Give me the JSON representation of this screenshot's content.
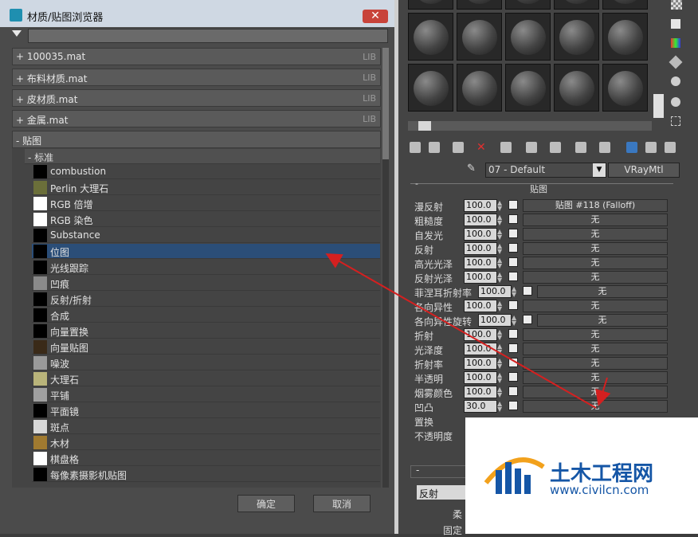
{
  "dialog": {
    "title": "材质/贴图浏览器",
    "close_glyph": "✕",
    "categories": [
      {
        "label": "+ 100035.mat",
        "tag": "LIB"
      },
      {
        "label": "+ 布料材质.mat",
        "tag": "LIB"
      },
      {
        "label": "+ 皮材质.mat",
        "tag": "LIB"
      },
      {
        "label": "+ 金属.mat",
        "tag": "LIB"
      }
    ],
    "maps_group": "- 贴图",
    "maps_subgroup": "- 标准",
    "maps": [
      {
        "name": "combustion",
        "swatch": "#000000"
      },
      {
        "name": "Perlin 大理石",
        "swatch": "#6b6f3a"
      },
      {
        "name": "RGB 倍增",
        "swatch": "#ffffff"
      },
      {
        "name": "RGB 染色",
        "swatch": "#ffffff"
      },
      {
        "name": "Substance",
        "swatch": "#000000"
      },
      {
        "name": "位图",
        "swatch": "#000000",
        "selected": true
      },
      {
        "name": "光线跟踪",
        "swatch": "#000000"
      },
      {
        "name": "凹痕",
        "swatch": "#8a8a8a"
      },
      {
        "name": "反射/折射",
        "swatch": "#000000"
      },
      {
        "name": "合成",
        "swatch": "#000000"
      },
      {
        "name": "向量置换",
        "swatch": "#000000"
      },
      {
        "name": "向量贴图",
        "swatch": "#3a2a18"
      },
      {
        "name": "噪波",
        "swatch": "#9a9a9a"
      },
      {
        "name": "大理石",
        "swatch": "#b9b47a"
      },
      {
        "name": "平铺",
        "swatch": "#a0a0a0"
      },
      {
        "name": "平面镜",
        "swatch": "#000000"
      },
      {
        "name": "斑点",
        "swatch": "#d8d8d8"
      },
      {
        "name": "木材",
        "swatch": "#a07a30"
      },
      {
        "name": "棋盘格",
        "swatch": "#ffffff"
      },
      {
        "name": "每像素摄影机贴图",
        "swatch": "#000000"
      }
    ],
    "ok_label": "确定",
    "cancel_label": "取消"
  },
  "editor": {
    "material_name": "07 - Default",
    "material_type": "VRayMtl",
    "rollout_title": "贴图",
    "rows": [
      {
        "label": "漫反射",
        "value": "100.0",
        "map": "贴图 #118 (Falloff)"
      },
      {
        "label": "粗糙度",
        "value": "100.0",
        "map": "无"
      },
      {
        "label": "自发光",
        "value": "100.0",
        "map": "无"
      },
      {
        "label": "反射",
        "value": "100.0",
        "map": "无"
      },
      {
        "label": "高光光泽",
        "value": "100.0",
        "map": "无"
      },
      {
        "label": "反射光泽",
        "value": "100.0",
        "map": "无"
      },
      {
        "label": "菲涅耳折射率",
        "value": "100.0",
        "map": "无"
      },
      {
        "label": "各向异性",
        "value": "100.0",
        "map": "无"
      },
      {
        "label": "各向异性旋转",
        "value": "100.0",
        "map": "无"
      },
      {
        "label": "折射",
        "value": "100.0",
        "map": "无"
      },
      {
        "label": "光泽度",
        "value": "100.0",
        "map": "无"
      },
      {
        "label": "折射率",
        "value": "100.0",
        "map": "无"
      },
      {
        "label": "半透明",
        "value": "100.0",
        "map": "无"
      },
      {
        "label": "烟雾颜色",
        "value": "100.0",
        "map": "无"
      },
      {
        "label": "凹凸",
        "value": "30.0",
        "map": "无"
      },
      {
        "label": "置换",
        "value": "",
        "map": ""
      },
      {
        "label": "不透明度",
        "value": "",
        "map": ""
      }
    ],
    "lower_rollout_sign": "-",
    "lower_field": "反射",
    "lower_label_1": "柔",
    "lower_label_2": "固定"
  },
  "watermark": {
    "name": "土木工程网",
    "url": "www.civilcn.com"
  },
  "colors": {
    "selection": "#2b4e78",
    "arrow": "#d42020"
  }
}
